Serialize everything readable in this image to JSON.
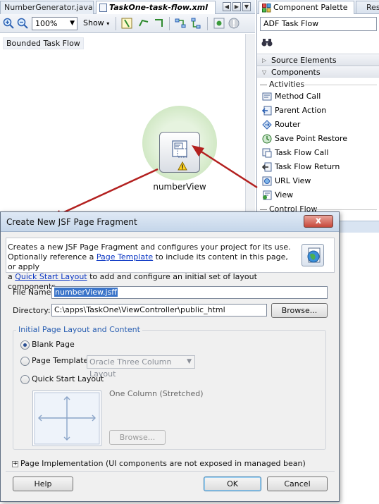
{
  "editor": {
    "tabs": [
      {
        "label": "NumberGenerator.java"
      },
      {
        "label": "TaskOne-task-flow.xml"
      }
    ],
    "toolbar": {
      "zoom_value": "100%",
      "show_label": "Show"
    },
    "canvas_label": "Bounded Task Flow",
    "node": {
      "label": "numberView"
    }
  },
  "palette": {
    "tab_label": "Component Palette",
    "tab2_label": "Res",
    "selector_value": "ADF Task Flow",
    "sections": [
      {
        "label": "Source Elements",
        "expanded": false
      },
      {
        "label": "Components",
        "expanded": true
      }
    ],
    "category_activities": "Activities",
    "items": [
      {
        "label": "Method Call",
        "icon": "method-call-icon"
      },
      {
        "label": "Parent Action",
        "icon": "parent-action-icon"
      },
      {
        "label": "Router",
        "icon": "router-icon"
      },
      {
        "label": "Save Point Restore",
        "icon": "save-point-icon"
      },
      {
        "label": "Task Flow Call",
        "icon": "task-flow-call-icon"
      },
      {
        "label": "Task Flow Return",
        "icon": "task-flow-return-icon"
      },
      {
        "label": "URL View",
        "icon": "url-view-icon"
      },
      {
        "label": "View",
        "icon": "view-icon"
      }
    ],
    "category_control_flow": "Control Flow"
  },
  "dialog": {
    "title": "Create New JSF Page Fragment",
    "close": "x",
    "desc_line1": "Creates a new JSF Page Fragment and configures your project for its use.",
    "desc_line2_pre": "Optionally reference a ",
    "desc_link_template": "Page Template",
    "desc_line2_post": " to include its content in this page, or apply",
    "desc_line3_pre": "a ",
    "desc_link_quickstart": "Quick Start Layout",
    "desc_line3_post": " to add and configure an initial set of layout components.",
    "file_name_label": "File Name:",
    "file_name_value": "numberView.jsff",
    "directory_label": "Directory:",
    "directory_value": "C:\\apps\\TaskOne\\ViewController\\public_html",
    "browse_label": "Browse...",
    "group_title": "Initial Page Layout and Content",
    "radio_blank": "Blank Page",
    "radio_template": "Page Template",
    "template_combo_value": "Oracle Three Column Layout",
    "radio_quickstart": "Quick Start Layout",
    "layout_name": "One Column (Stretched)",
    "browse2_label": "Browse...",
    "impl_label": "Page Implementation (UI components are not exposed in managed bean)",
    "help_label": "Help",
    "ok_label": "OK",
    "cancel_label": "Cancel"
  },
  "colors": {
    "arrow": "#b3201f",
    "link": "#0b36c3",
    "selection": "#3a74c9",
    "group_title": "#2a5fb2"
  }
}
